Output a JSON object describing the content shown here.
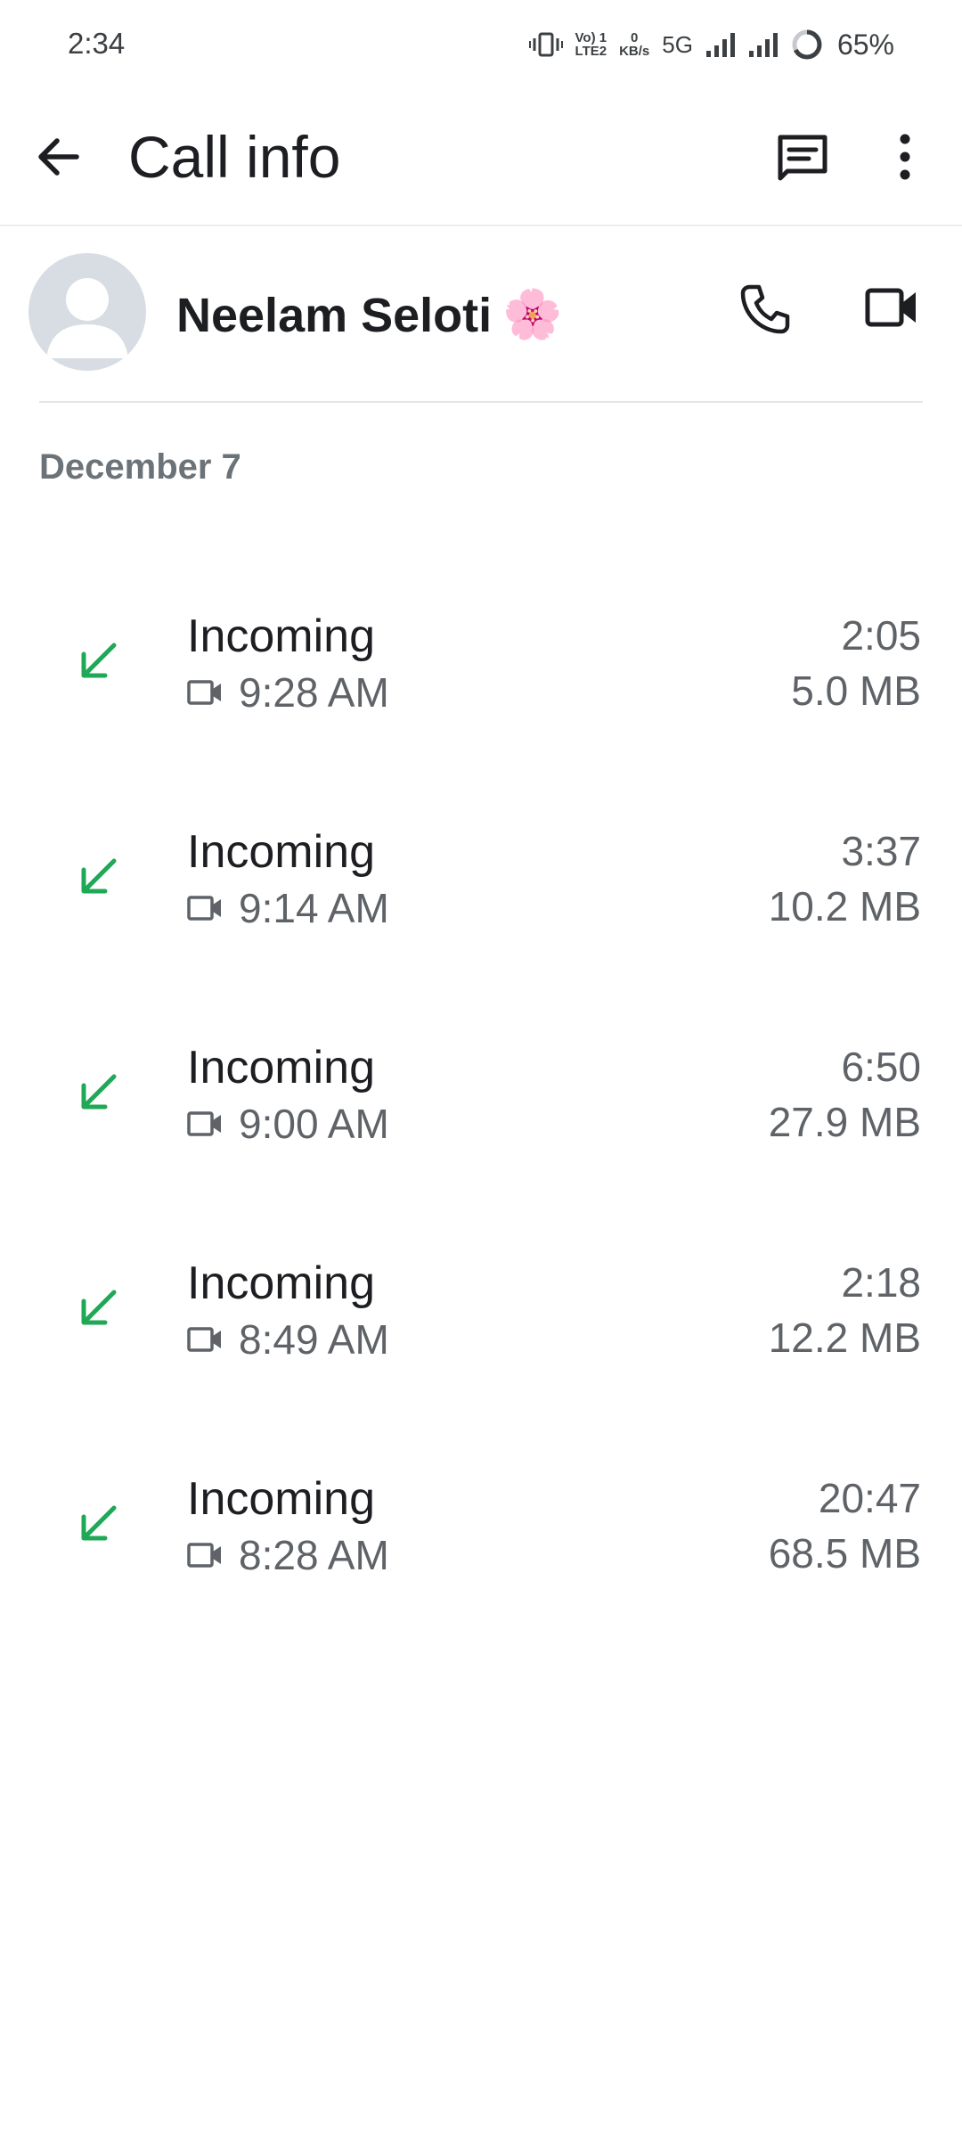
{
  "status_bar": {
    "time": "2:34",
    "volte_top": "Vo) 1",
    "volte_bottom": "LTE2",
    "speed_top": "0",
    "speed_bottom": "KB/s",
    "network": "5G",
    "battery": "65%"
  },
  "app_bar": {
    "title": "Call info",
    "back_icon": "arrow-back-icon",
    "message_icon": "message-icon",
    "menu_icon": "more-vert-icon"
  },
  "contact": {
    "name": "Neelam Seloti",
    "emoji": "🌸",
    "call_icon": "phone-icon",
    "video_icon": "videocam-icon"
  },
  "date_header": "December 7",
  "colors": {
    "incoming_arrow": "#1fa855",
    "secondary_text": "#5f6368",
    "date_header": "#6c7378"
  },
  "calls": [
    {
      "type": "Incoming",
      "time": "9:28 AM",
      "duration": "2:05",
      "size": "5.0 MB"
    },
    {
      "type": "Incoming",
      "time": "9:14 AM",
      "duration": "3:37",
      "size": "10.2 MB"
    },
    {
      "type": "Incoming",
      "time": "9:00 AM",
      "duration": "6:50",
      "size": "27.9 MB"
    },
    {
      "type": "Incoming",
      "time": "8:49 AM",
      "duration": "2:18",
      "size": "12.2 MB"
    },
    {
      "type": "Incoming",
      "time": "8:28 AM",
      "duration": "20:47",
      "size": "68.5 MB"
    }
  ]
}
